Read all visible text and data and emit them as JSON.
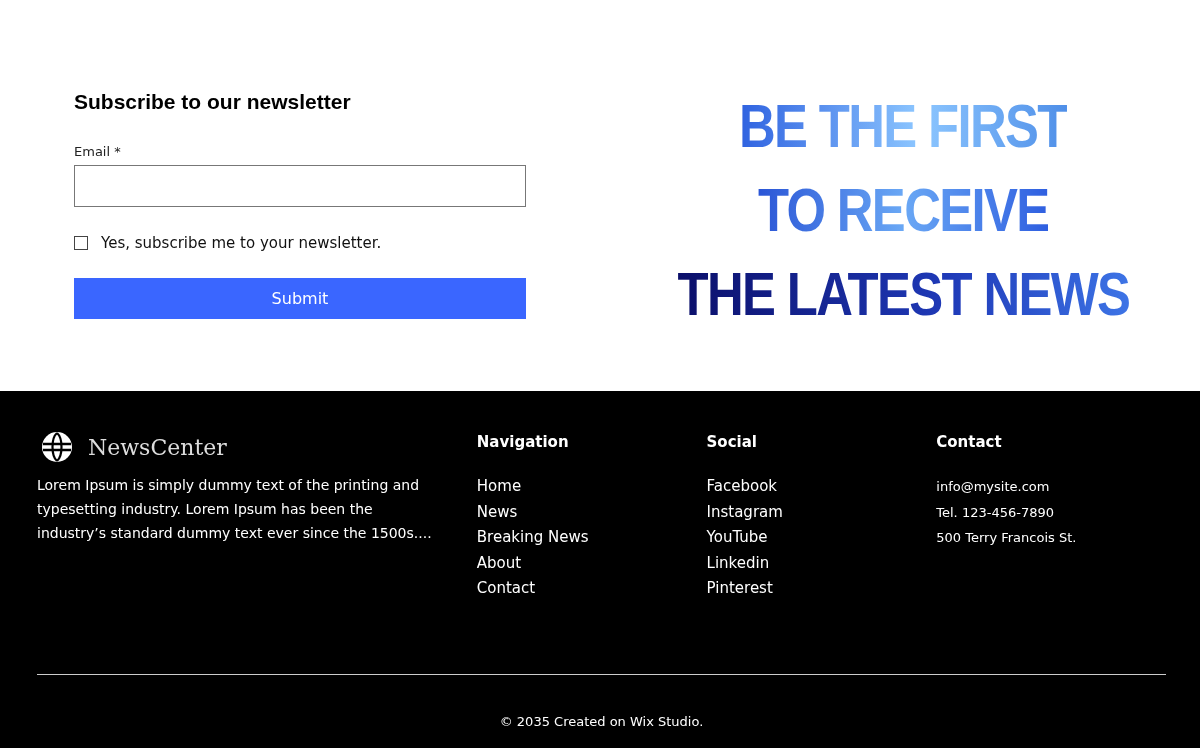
{
  "newsletter": {
    "title": "Subscribe to our newsletter",
    "email_label": "Email *",
    "checkbox": {
      "label": "Yes, subscribe me to your newsletter.",
      "checked": false
    },
    "submit": "Submit"
  },
  "headline": [
    "BE THE FIRST",
    "TO RECEIVE",
    "THE LATEST NEWS"
  ],
  "footer": {
    "brand": "NewsCenter",
    "about": "Lorem Ipsum is simply dummy text of the printing and typesetting industry. Lorem Ipsum has been the industry’s standard dummy text ever since the 1500s....",
    "columns": [
      {
        "title": "Navigation",
        "kind": "links",
        "items": [
          "Home",
          "News",
          "Breaking News",
          "About",
          "Contact"
        ]
      },
      {
        "title": "Social",
        "kind": "links",
        "items": [
          "Facebook",
          "Instagram",
          "YouTube",
          "Linkedin",
          "Pinterest"
        ]
      },
      {
        "title": "Contact",
        "kind": "info",
        "items": [
          "info@mysite.com",
          "Tel. 123-456-7890",
          "500 Terry Francois St."
        ]
      }
    ],
    "copyright": "© 2035  Created on Wix Studio."
  }
}
